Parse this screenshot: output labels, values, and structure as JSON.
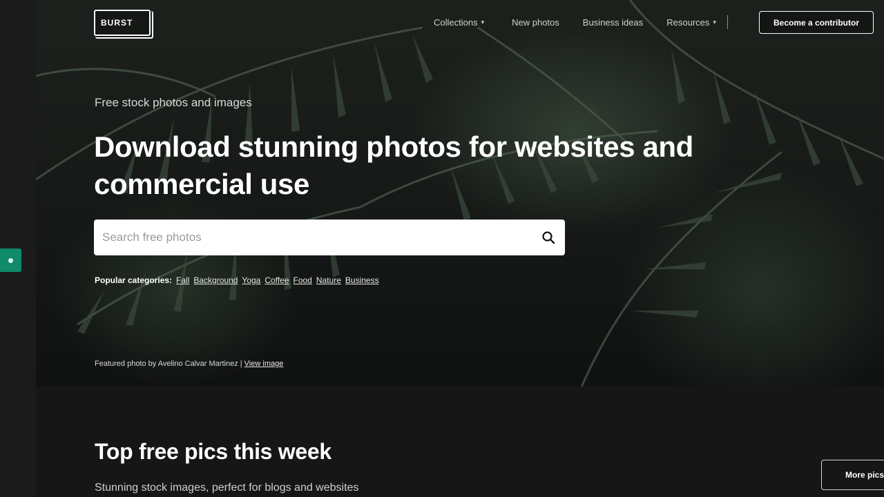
{
  "brand": {
    "logo_text": "BURST"
  },
  "nav": {
    "items": [
      {
        "label": "Collections",
        "has_caret": true
      },
      {
        "label": "New photos",
        "has_caret": false
      },
      {
        "label": "Business ideas",
        "has_caret": false
      },
      {
        "label": "Resources",
        "has_caret": true
      }
    ],
    "contributor_button": "Become a contributor"
  },
  "hero": {
    "eyebrow": "Free stock photos and images",
    "headline": "Download stunning photos for websites and commercial use",
    "search": {
      "placeholder": "Search free photos",
      "value": ""
    },
    "popular_label": "Popular categories:",
    "categories": [
      "Fall",
      "Background",
      "Yoga",
      "Coffee",
      "Food",
      "Nature",
      "Business"
    ],
    "credit_text": "Featured photo by Avelino Calvar Martinez |",
    "credit_link": "View image"
  },
  "section": {
    "title": "Top free pics this week",
    "subtitle": "Stunning stock images, perfect for blogs and websites",
    "more_button": "More pics"
  },
  "colors": {
    "side_widget": "#0f8a6a",
    "background": "#161617"
  },
  "icons": {
    "search": "search-icon",
    "caret": "chevron-down-icon"
  }
}
